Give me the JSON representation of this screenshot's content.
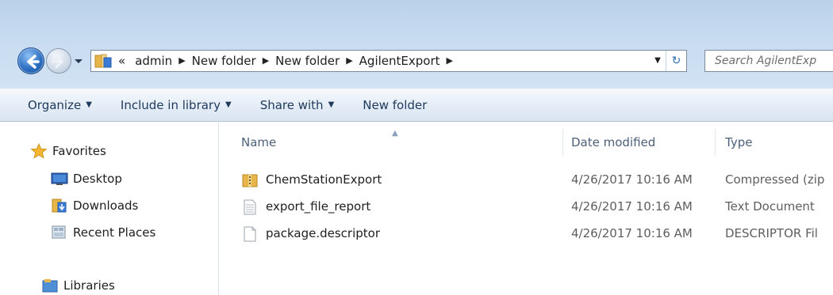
{
  "address": {
    "overflow": "«",
    "crumbs": [
      "admin",
      "New folder",
      "New folder",
      "AgilentExport"
    ],
    "search_placeholder": "Search AgilentExp"
  },
  "toolbar": {
    "organize": "Organize",
    "include_in_library": "Include in library",
    "share_with": "Share with",
    "new_folder": "New folder"
  },
  "nav": {
    "favorites": "Favorites",
    "desktop": "Desktop",
    "downloads": "Downloads",
    "recent_places": "Recent Places",
    "libraries": "Libraries"
  },
  "columns": {
    "name": "Name",
    "date": "Date modified",
    "type": "Type"
  },
  "files": [
    {
      "name": "ChemStationExport",
      "date": "4/26/2017 10:16 AM",
      "type": "Compressed (zip"
    },
    {
      "name": "export_file_report",
      "date": "4/26/2017 10:16 AM",
      "type": "Text Document"
    },
    {
      "name": "package.descriptor",
      "date": "4/26/2017 10:16 AM",
      "type": "DESCRIPTOR Fil"
    }
  ],
  "colors": {
    "glass": "#c7dbf0",
    "toolbar_text": "#1e395b",
    "header_text": "#4c607a"
  }
}
